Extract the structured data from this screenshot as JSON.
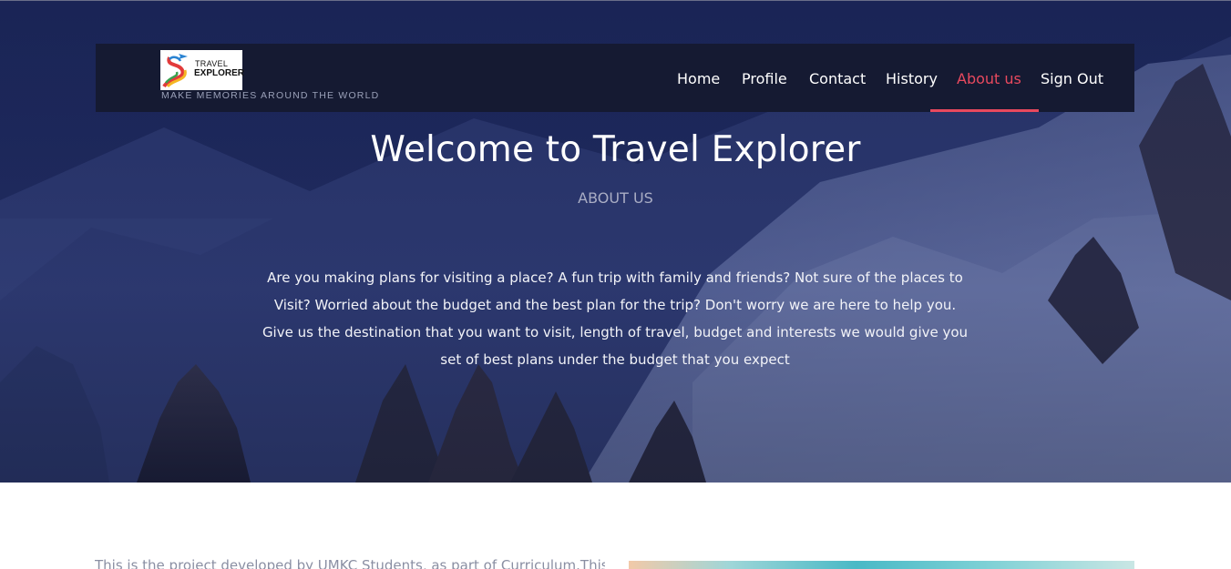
{
  "brand": {
    "logo_line1": "TRAVEL",
    "logo_line2": "EXPLORER",
    "tagline": "MAKE MEMORIES AROUND THE WORLD"
  },
  "nav": {
    "items": [
      {
        "label": "Home",
        "active": false
      },
      {
        "label": "Profile",
        "active": false
      },
      {
        "label": "Contact",
        "active": false
      },
      {
        "label": "History",
        "active": false
      },
      {
        "label": "About us",
        "active": true
      },
      {
        "label": "Sign Out",
        "active": false
      }
    ],
    "accent_color": "#e8495e"
  },
  "hero": {
    "title": "Welcome to Travel Explorer",
    "subtitle": "ABOUT US",
    "body": "Are you making plans for visiting a place? A fun trip with family and friends? Not sure of the places to Visit? Worried about the budget and the best plan for the trip? Don't worry we are here to help you. Give us the destination that you want to visit, length of travel, budget and interests we would give you set of best plans under the budget that you expect"
  },
  "section": {
    "text": "This is the project developed by UMKC Students, as part of Curriculum.This"
  }
}
